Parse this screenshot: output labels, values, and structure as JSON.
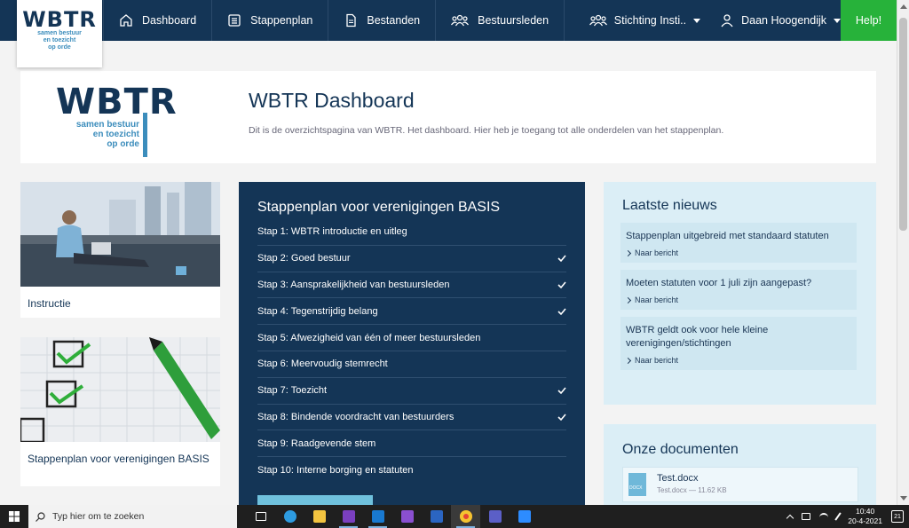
{
  "nav": {
    "logo_text": "WBTR",
    "logo_tagline": [
      "samen bestuur",
      "en toezicht",
      "op orde"
    ],
    "items": [
      {
        "label": "Dashboard",
        "icon": "home-icon"
      },
      {
        "label": "Stappenplan",
        "icon": "list-icon"
      },
      {
        "label": "Bestanden",
        "icon": "file-icon"
      },
      {
        "label": "Bestuursleden",
        "icon": "users-icon"
      }
    ],
    "organization": "Stichting Insti..",
    "user": "Daan Hoogendijk",
    "help": "Help!"
  },
  "header": {
    "title": "WBTR Dashboard",
    "subtitle": "Dit is de overzichtspagina van WBTR. Het dashboard. Hier heb je toegang tot alle onderdelen van het stappenplan."
  },
  "cards": {
    "instruction": "Instructie",
    "stappenplan": "Stappenplan voor verenigingen BASIS"
  },
  "plan": {
    "title": "Stappenplan voor verenigingen BASIS",
    "steps": [
      {
        "label": "Stap 1: WBTR introductie en uitleg",
        "done": false
      },
      {
        "label": "Stap 2: Goed bestuur",
        "done": true
      },
      {
        "label": "Stap 3: Aansprakelijkheid van bestuursleden",
        "done": true
      },
      {
        "label": "Stap 4: Tegenstrijdig belang",
        "done": true
      },
      {
        "label": "Stap 5: Afwezigheid van één of meer bestuursleden",
        "done": false
      },
      {
        "label": "Stap 6: Meervoudig stemrecht",
        "done": false
      },
      {
        "label": "Stap 7: Toezicht",
        "done": true
      },
      {
        "label": "Stap 8: Bindende voordracht van bestuurders",
        "done": true
      },
      {
        "label": "Stap 9: Raadgevende stem",
        "done": false
      },
      {
        "label": "Stap 10: Interne borging en statuten",
        "done": false
      }
    ]
  },
  "news": {
    "title": "Laatste nieuws",
    "link_label": "Naar bericht",
    "items": [
      "Stappenplan uitgebreid met standaard statuten",
      "Moeten statuten voor 1 juli zijn aangepast?",
      "WBTR geldt ook voor hele kleine verenigingen/stichtingen"
    ]
  },
  "documents": {
    "title": "Onze documenten",
    "items": [
      {
        "name": "Test.docx",
        "meta": "Test.docx — 11.62 KB",
        "icon_label": "DOCX"
      }
    ]
  },
  "taskbar": {
    "search_placeholder": "Typ hier om te zoeken",
    "time": "10:40",
    "date": "20-4-2021",
    "notifications": "21"
  }
}
